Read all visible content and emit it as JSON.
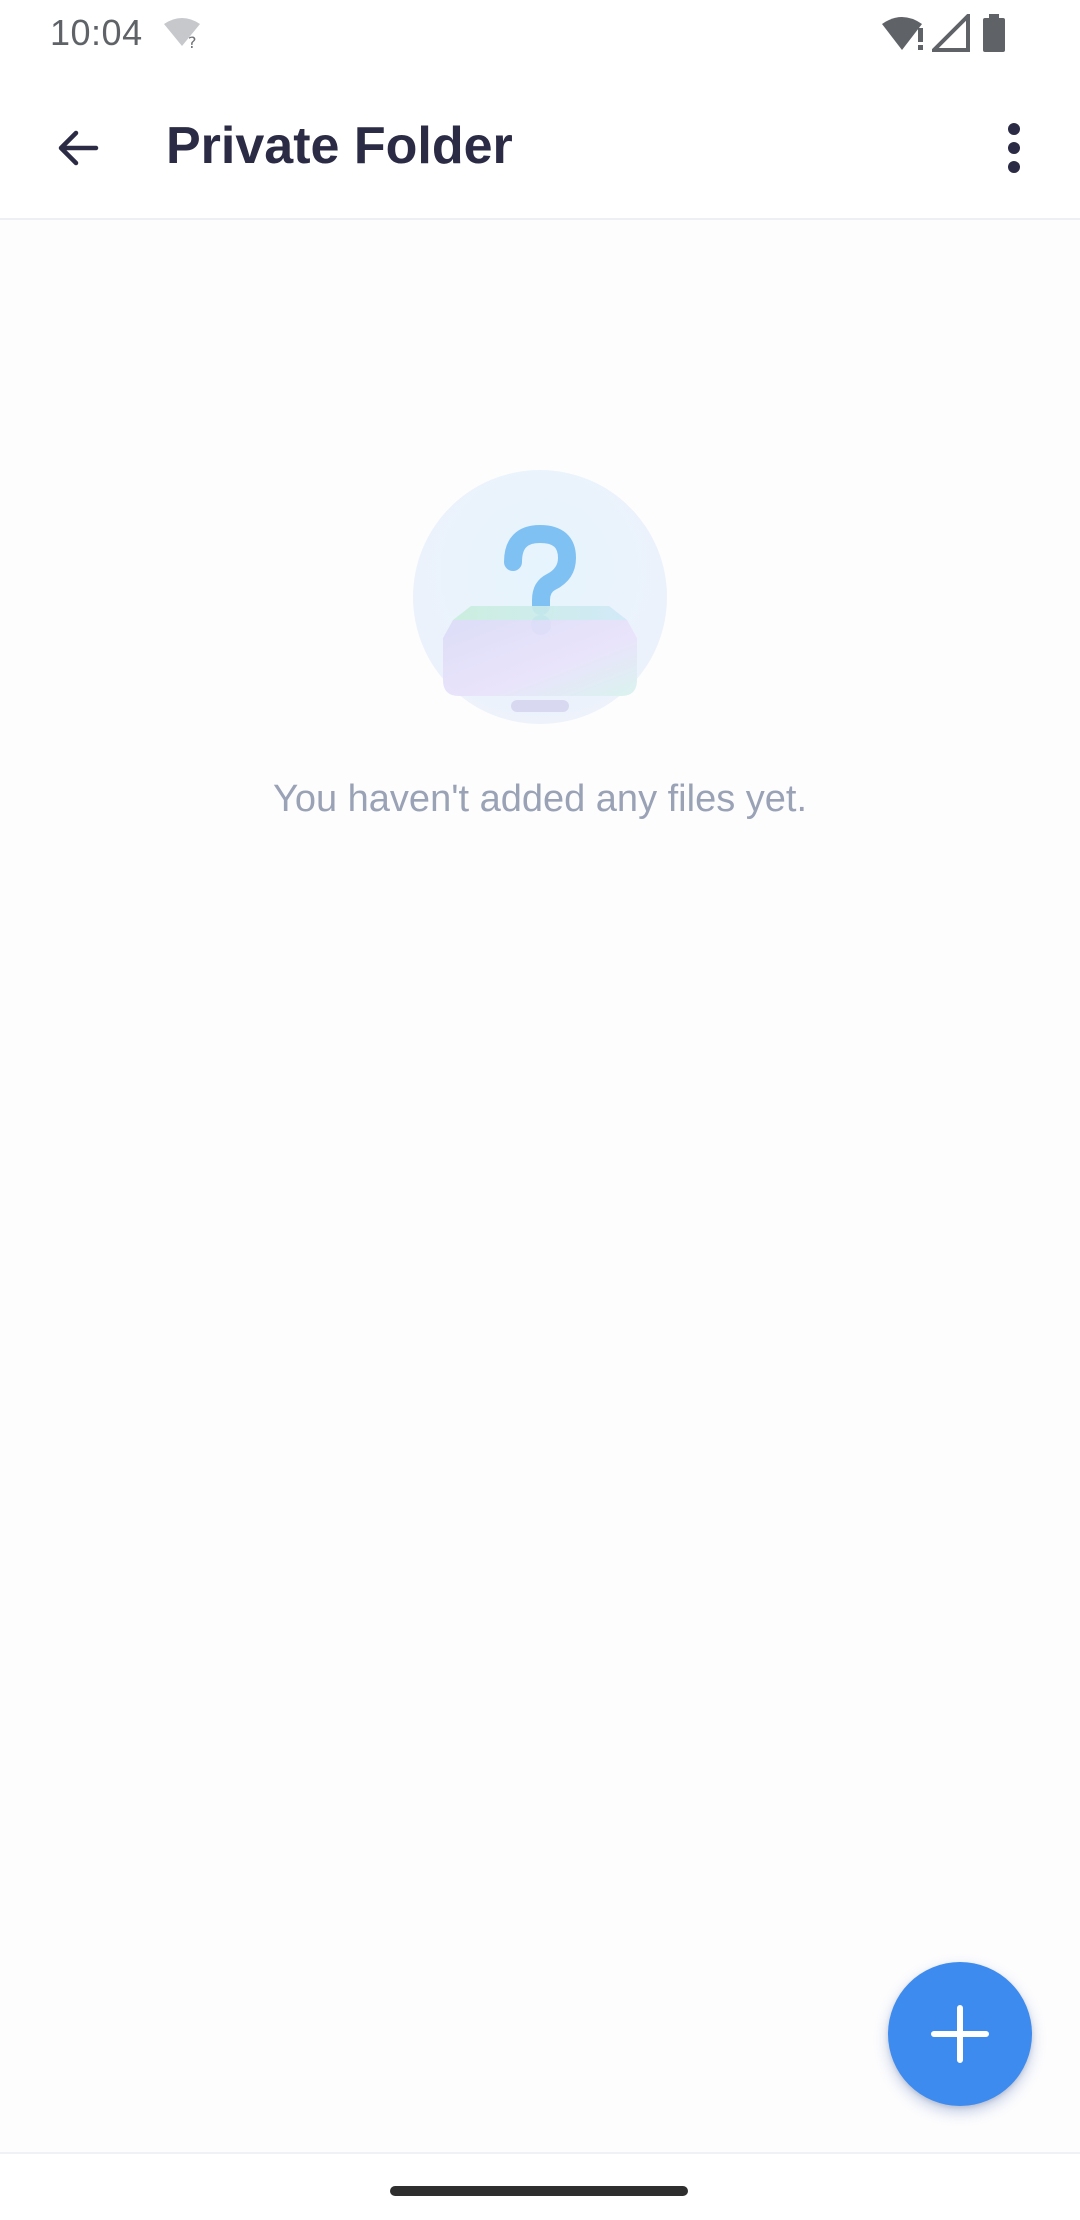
{
  "status_bar": {
    "time": "10:04"
  },
  "app_bar": {
    "title": "Private Folder",
    "back_icon": "arrow-left-icon",
    "more_icon": "more-vertical-icon"
  },
  "empty_state": {
    "illustration_icon": "empty-box-question-icon",
    "message": "You haven't added any files yet."
  },
  "fab": {
    "icon": "plus-icon",
    "color": "#3d8bef"
  },
  "colors": {
    "title": "#2b2b45",
    "empty_text": "#9aa2b6",
    "accent": "#3d8bef"
  }
}
